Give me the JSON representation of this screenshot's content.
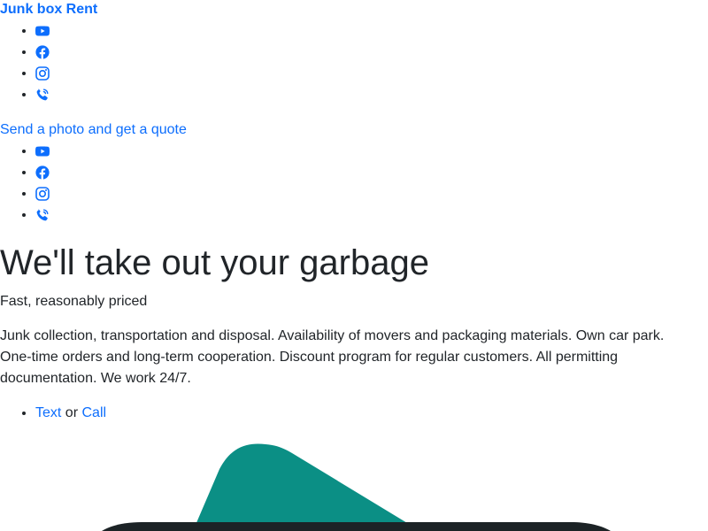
{
  "brand": {
    "name": "Junk box Rent",
    "color": "#0d6efd"
  },
  "social_links": [
    {
      "icon": "youtube-icon"
    },
    {
      "icon": "facebook-icon"
    },
    {
      "icon": "instagram-icon"
    },
    {
      "icon": "phone-call-icon"
    }
  ],
  "quote_link": {
    "label": "Send a photo and get a quote"
  },
  "hero": {
    "title": "We'll take out your garbage",
    "tagline": "Fast, reasonably priced",
    "description": "Junk collection, transportation and disposal. Availability of movers and packaging materials. Own car park. One-time orders and long-term cooperation. Discount program for regular customers. All permitting documentation. We work 24/7.",
    "cta": {
      "text_label": "Text",
      "separator": "or",
      "call_label": "Call"
    }
  },
  "colors": {
    "link": "#0d6efd",
    "text": "#212529",
    "teal_shape": "#0b8f85",
    "dark_shape": "#1c2326"
  }
}
